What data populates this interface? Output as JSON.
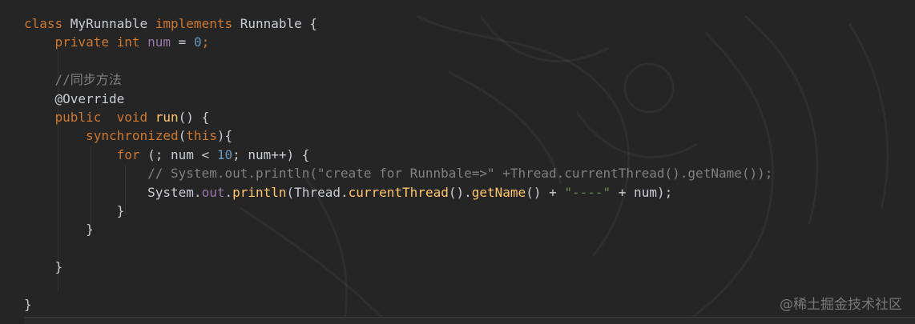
{
  "code": {
    "lines": [
      [
        {
          "t": "class ",
          "c": "kw"
        },
        {
          "t": "MyRunnable ",
          "c": "cls"
        },
        {
          "t": "implements ",
          "c": "kw"
        },
        {
          "t": "Runnable {",
          "c": "cls"
        }
      ],
      [
        {
          "t": "    private ",
          "c": "kw"
        },
        {
          "t": "int ",
          "c": "kw"
        },
        {
          "t": "num",
          "c": "field"
        },
        {
          "t": " = ",
          "c": "cls"
        },
        {
          "t": "0",
          "c": "num"
        },
        {
          "t": ";",
          "c": "kw"
        }
      ],
      [],
      [
        {
          "t": "    //同步方法",
          "c": "comment"
        }
      ],
      [
        {
          "t": "    @Override",
          "c": "ann2"
        }
      ],
      [
        {
          "t": "    public  ",
          "c": "kw"
        },
        {
          "t": "void ",
          "c": "kw"
        },
        {
          "t": "run",
          "c": "fn"
        },
        {
          "t": "() {",
          "c": "cls"
        }
      ],
      [
        {
          "t": "        synchronized",
          "c": "kw"
        },
        {
          "t": "(",
          "c": "cls"
        },
        {
          "t": "this",
          "c": "kw"
        },
        {
          "t": "){",
          "c": "cls"
        }
      ],
      [
        {
          "t": "            for ",
          "c": "kw"
        },
        {
          "t": "(; num < ",
          "c": "cls"
        },
        {
          "t": "10",
          "c": "num"
        },
        {
          "t": "; num++) {",
          "c": "cls"
        }
      ],
      [
        {
          "t": "                // System.out.println(\"create for Runnbale=>\" +Thread.currentThread().getName());",
          "c": "comment"
        }
      ],
      [
        {
          "t": "                System.",
          "c": "cls"
        },
        {
          "t": "out",
          "c": "field"
        },
        {
          "t": ".",
          "c": "cls"
        },
        {
          "t": "println",
          "c": "call"
        },
        {
          "t": "(Thread.",
          "c": "cls"
        },
        {
          "t": "currentThread",
          "c": "call"
        },
        {
          "t": "().",
          "c": "cls"
        },
        {
          "t": "getName",
          "c": "call"
        },
        {
          "t": "() + ",
          "c": "cls"
        },
        {
          "t": "\"----\"",
          "c": "str"
        },
        {
          "t": " + num);",
          "c": "cls"
        }
      ],
      [
        {
          "t": "            }",
          "c": "cls"
        }
      ],
      [
        {
          "t": "        }",
          "c": "cls"
        }
      ],
      [],
      [
        {
          "t": "    }",
          "c": "cls"
        }
      ],
      [],
      [
        {
          "t": "}",
          "c": "cls"
        }
      ]
    ]
  },
  "watermark": "@稀土掘金技术社区",
  "colors": {
    "background": "#252525",
    "keyword": "#cc7832",
    "field": "#9876aa",
    "number": "#6897bb",
    "comment": "#808080",
    "function": "#ffc66d",
    "string": "#6a8759",
    "text": "#c9ccd2"
  }
}
